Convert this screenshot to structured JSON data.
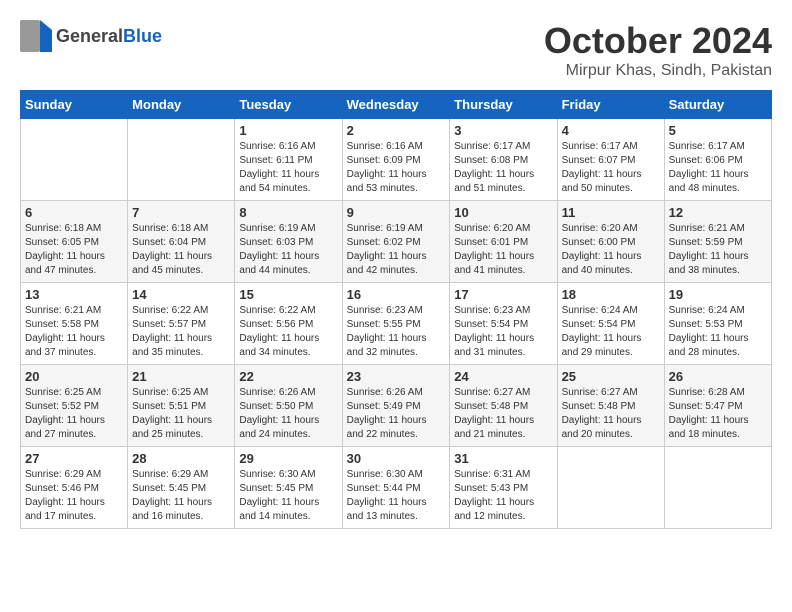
{
  "header": {
    "logo_general": "General",
    "logo_blue": "Blue",
    "month_title": "October 2024",
    "location": "Mirpur Khas, Sindh, Pakistan"
  },
  "calendar": {
    "days_of_week": [
      "Sunday",
      "Monday",
      "Tuesday",
      "Wednesday",
      "Thursday",
      "Friday",
      "Saturday"
    ],
    "weeks": [
      [
        {
          "day": "",
          "info": ""
        },
        {
          "day": "",
          "info": ""
        },
        {
          "day": "1",
          "info": "Sunrise: 6:16 AM\nSunset: 6:11 PM\nDaylight: 11 hours\nand 54 minutes."
        },
        {
          "day": "2",
          "info": "Sunrise: 6:16 AM\nSunset: 6:09 PM\nDaylight: 11 hours\nand 53 minutes."
        },
        {
          "day": "3",
          "info": "Sunrise: 6:17 AM\nSunset: 6:08 PM\nDaylight: 11 hours\nand 51 minutes."
        },
        {
          "day": "4",
          "info": "Sunrise: 6:17 AM\nSunset: 6:07 PM\nDaylight: 11 hours\nand 50 minutes."
        },
        {
          "day": "5",
          "info": "Sunrise: 6:17 AM\nSunset: 6:06 PM\nDaylight: 11 hours\nand 48 minutes."
        }
      ],
      [
        {
          "day": "6",
          "info": "Sunrise: 6:18 AM\nSunset: 6:05 PM\nDaylight: 11 hours\nand 47 minutes."
        },
        {
          "day": "7",
          "info": "Sunrise: 6:18 AM\nSunset: 6:04 PM\nDaylight: 11 hours\nand 45 minutes."
        },
        {
          "day": "8",
          "info": "Sunrise: 6:19 AM\nSunset: 6:03 PM\nDaylight: 11 hours\nand 44 minutes."
        },
        {
          "day": "9",
          "info": "Sunrise: 6:19 AM\nSunset: 6:02 PM\nDaylight: 11 hours\nand 42 minutes."
        },
        {
          "day": "10",
          "info": "Sunrise: 6:20 AM\nSunset: 6:01 PM\nDaylight: 11 hours\nand 41 minutes."
        },
        {
          "day": "11",
          "info": "Sunrise: 6:20 AM\nSunset: 6:00 PM\nDaylight: 11 hours\nand 40 minutes."
        },
        {
          "day": "12",
          "info": "Sunrise: 6:21 AM\nSunset: 5:59 PM\nDaylight: 11 hours\nand 38 minutes."
        }
      ],
      [
        {
          "day": "13",
          "info": "Sunrise: 6:21 AM\nSunset: 5:58 PM\nDaylight: 11 hours\nand 37 minutes."
        },
        {
          "day": "14",
          "info": "Sunrise: 6:22 AM\nSunset: 5:57 PM\nDaylight: 11 hours\nand 35 minutes."
        },
        {
          "day": "15",
          "info": "Sunrise: 6:22 AM\nSunset: 5:56 PM\nDaylight: 11 hours\nand 34 minutes."
        },
        {
          "day": "16",
          "info": "Sunrise: 6:23 AM\nSunset: 5:55 PM\nDaylight: 11 hours\nand 32 minutes."
        },
        {
          "day": "17",
          "info": "Sunrise: 6:23 AM\nSunset: 5:54 PM\nDaylight: 11 hours\nand 31 minutes."
        },
        {
          "day": "18",
          "info": "Sunrise: 6:24 AM\nSunset: 5:54 PM\nDaylight: 11 hours\nand 29 minutes."
        },
        {
          "day": "19",
          "info": "Sunrise: 6:24 AM\nSunset: 5:53 PM\nDaylight: 11 hours\nand 28 minutes."
        }
      ],
      [
        {
          "day": "20",
          "info": "Sunrise: 6:25 AM\nSunset: 5:52 PM\nDaylight: 11 hours\nand 27 minutes."
        },
        {
          "day": "21",
          "info": "Sunrise: 6:25 AM\nSunset: 5:51 PM\nDaylight: 11 hours\nand 25 minutes."
        },
        {
          "day": "22",
          "info": "Sunrise: 6:26 AM\nSunset: 5:50 PM\nDaylight: 11 hours\nand 24 minutes."
        },
        {
          "day": "23",
          "info": "Sunrise: 6:26 AM\nSunset: 5:49 PM\nDaylight: 11 hours\nand 22 minutes."
        },
        {
          "day": "24",
          "info": "Sunrise: 6:27 AM\nSunset: 5:48 PM\nDaylight: 11 hours\nand 21 minutes."
        },
        {
          "day": "25",
          "info": "Sunrise: 6:27 AM\nSunset: 5:48 PM\nDaylight: 11 hours\nand 20 minutes."
        },
        {
          "day": "26",
          "info": "Sunrise: 6:28 AM\nSunset: 5:47 PM\nDaylight: 11 hours\nand 18 minutes."
        }
      ],
      [
        {
          "day": "27",
          "info": "Sunrise: 6:29 AM\nSunset: 5:46 PM\nDaylight: 11 hours\nand 17 minutes."
        },
        {
          "day": "28",
          "info": "Sunrise: 6:29 AM\nSunset: 5:45 PM\nDaylight: 11 hours\nand 16 minutes."
        },
        {
          "day": "29",
          "info": "Sunrise: 6:30 AM\nSunset: 5:45 PM\nDaylight: 11 hours\nand 14 minutes."
        },
        {
          "day": "30",
          "info": "Sunrise: 6:30 AM\nSunset: 5:44 PM\nDaylight: 11 hours\nand 13 minutes."
        },
        {
          "day": "31",
          "info": "Sunrise: 6:31 AM\nSunset: 5:43 PM\nDaylight: 11 hours\nand 12 minutes."
        },
        {
          "day": "",
          "info": ""
        },
        {
          "day": "",
          "info": ""
        }
      ]
    ]
  }
}
